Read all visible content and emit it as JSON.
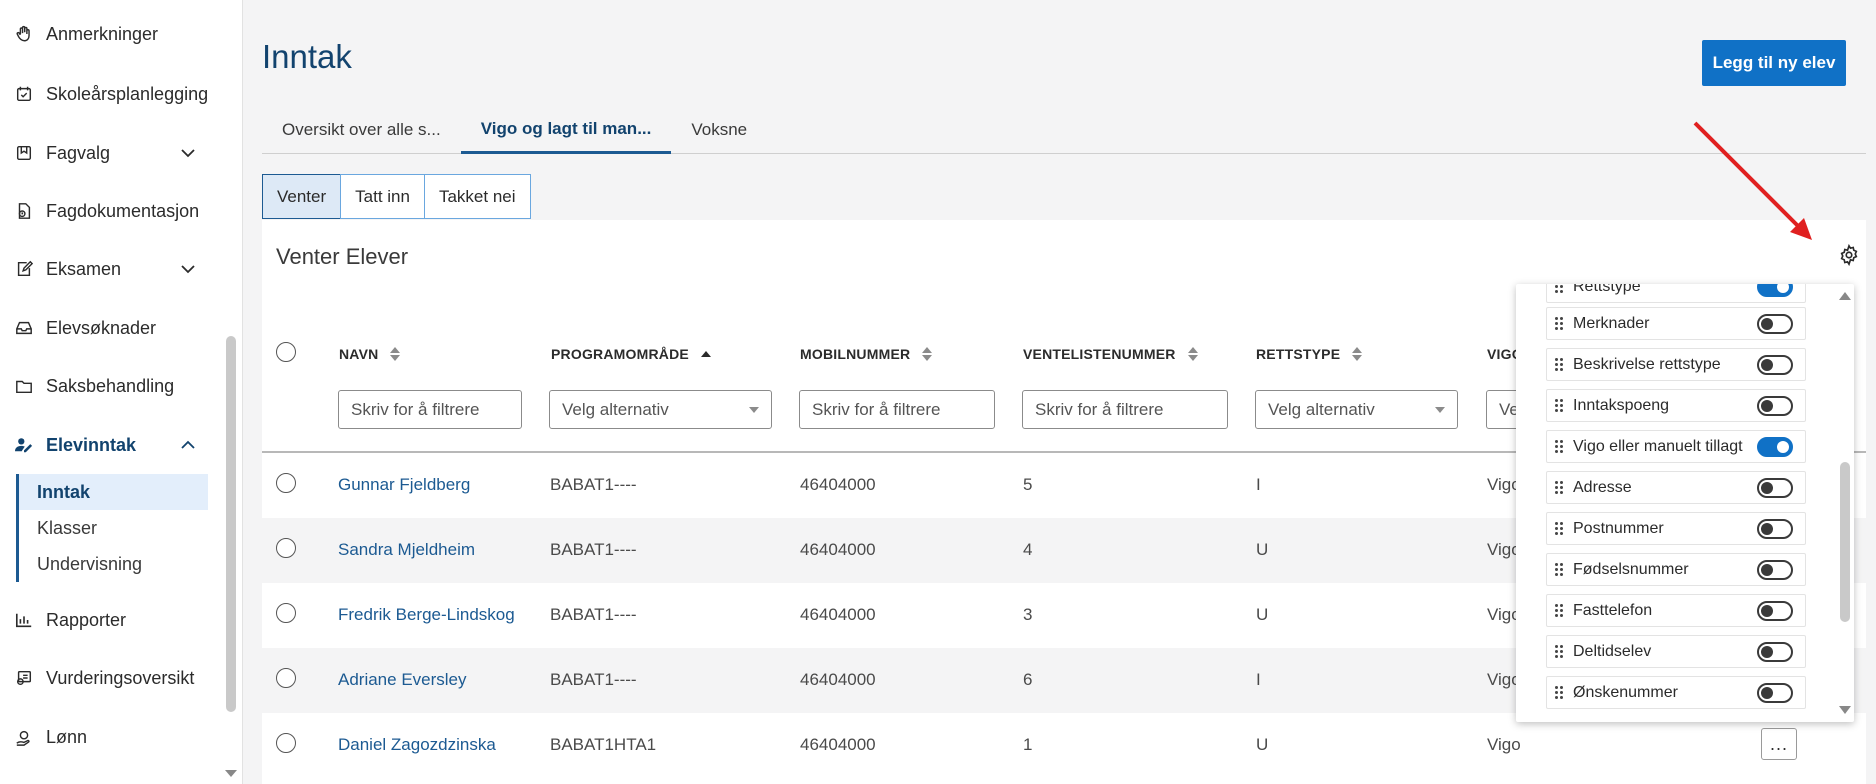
{
  "sidebar": {
    "items": [
      {
        "label": "Anmerkninger",
        "icon": "hand-icon"
      },
      {
        "label": "Skoleårsplanlegging",
        "icon": "calendar-icon"
      },
      {
        "label": "Fagvalg",
        "icon": "bookmark-icon"
      },
      {
        "label": "Fagdokumentasjon",
        "icon": "document-icon"
      },
      {
        "label": "Eksamen",
        "icon": "edit-icon"
      },
      {
        "label": "Elevsøknader",
        "icon": "inbox-icon"
      },
      {
        "label": "Saksbehandling",
        "icon": "folder-icon"
      },
      {
        "label": "Elevinntak",
        "icon": "user-edit-icon"
      },
      {
        "label": "Rapporter",
        "icon": "chart-icon"
      },
      {
        "label": "Vurderingsoversikt",
        "icon": "certificate-icon"
      },
      {
        "label": "Lønn",
        "icon": "money-icon"
      }
    ],
    "sub_items": [
      {
        "label": "Inntak"
      },
      {
        "label": "Klasser"
      },
      {
        "label": "Undervisning"
      }
    ]
  },
  "header": {
    "title": "Inntak",
    "add_button": "Legg til ny elev"
  },
  "tabs": [
    "Oversikt over alle s...",
    "Vigo og lagt til man...",
    "Voksne"
  ],
  "segments": [
    "Venter",
    "Tatt inn",
    "Takket nei"
  ],
  "card": {
    "title": "Venter Elever"
  },
  "table": {
    "columns": [
      "NAVN",
      "PROGRAMOMRÅDE",
      "MOBILNUMMER",
      "VENTELISTENUMMER",
      "RETTSTYPE",
      "VIGO"
    ],
    "filters": {
      "text_placeholder": "Skriv for å filtrere",
      "select_placeholder": "Velg alternativ",
      "partial": "Ve"
    },
    "rows": [
      {
        "navn": "Gunnar Fjeldberg",
        "program": "BABAT1----",
        "mobil": "46404000",
        "venteliste": "5",
        "rettstype": "I",
        "vigo": "Vigo"
      },
      {
        "navn": "Sandra Mjeldheim",
        "program": "BABAT1----",
        "mobil": "46404000",
        "venteliste": "4",
        "rettstype": "U",
        "vigo": "Vigo"
      },
      {
        "navn": "Fredrik Berge-Lindskog",
        "program": "BABAT1----",
        "mobil": "46404000",
        "venteliste": "3",
        "rettstype": "U",
        "vigo": "Vigo"
      },
      {
        "navn": "Adriane Eversley",
        "program": "BABAT1----",
        "mobil": "46404000",
        "venteliste": "6",
        "rettstype": "I",
        "vigo": "Vigo"
      },
      {
        "navn": "Daniel Zagozdzinska",
        "program": "BABAT1HTA1",
        "mobil": "46404000",
        "venteliste": "1",
        "rettstype": "U",
        "vigo": "Vigo"
      }
    ],
    "more_label": "..."
  },
  "column_settings": {
    "items": [
      {
        "label": "Rettstype",
        "on": true
      },
      {
        "label": "Merknader",
        "on": false
      },
      {
        "label": "Beskrivelse rettstype",
        "on": false
      },
      {
        "label": "Inntakspoeng",
        "on": false
      },
      {
        "label": "Vigo eller manuelt tillagt",
        "on": true
      },
      {
        "label": "Adresse",
        "on": false
      },
      {
        "label": "Postnummer",
        "on": false
      },
      {
        "label": "Fødselsnummer",
        "on": false
      },
      {
        "label": "Fasttelefon",
        "on": false
      },
      {
        "label": "Deltidselev",
        "on": false
      },
      {
        "label": "Ønskenummer",
        "on": false
      }
    ]
  },
  "colors": {
    "accent": "#1071c6",
    "nav_active": "#12436e",
    "link": "#1c5a92",
    "annotation_arrow": "#e02020"
  }
}
